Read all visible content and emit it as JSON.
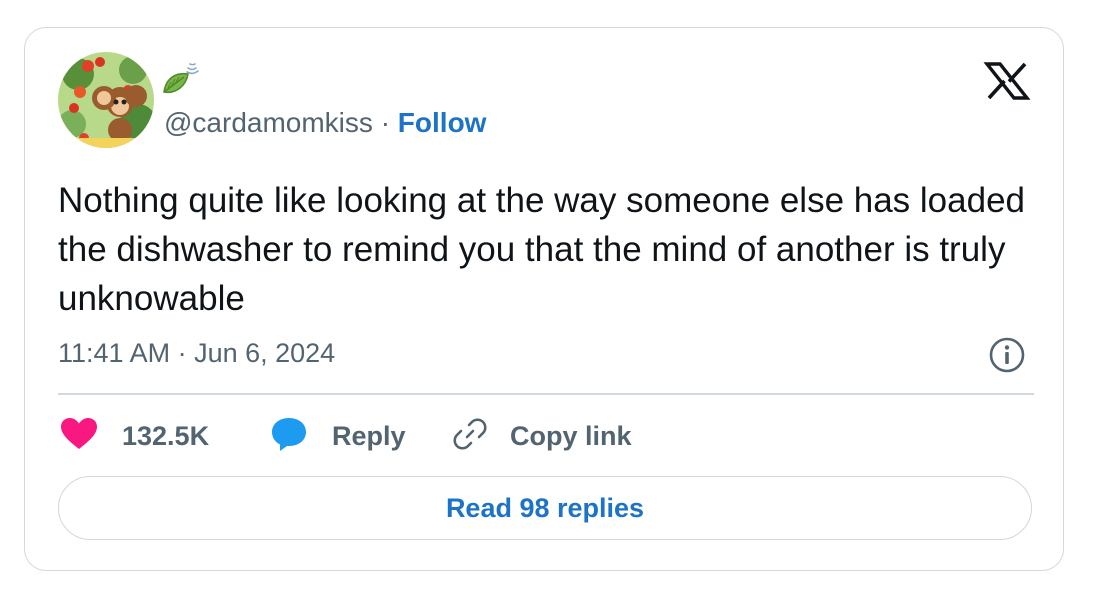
{
  "author": {
    "handle": "@cardamomkiss",
    "separator": "·",
    "follow_label": "Follow",
    "avatar_icon": "cheburashka-flowers-avatar",
    "name_emoji_icon": "leaf-fluttering-in-wind-icon"
  },
  "tweet": {
    "text": "Nothing quite like looking at the way someone else has loaded the dishwasher to remind you that the mind of another is truly unknowable",
    "timestamp": "11:41 AM · Jun 6, 2024"
  },
  "actions": {
    "likes_count": "132.5K",
    "reply_label": "Reply",
    "copy_link_label": "Copy link",
    "read_replies_label": "Read 98 replies"
  },
  "colors": {
    "like": "#f91880",
    "reply_bubble": "#1d9bf0",
    "link": "#1d73c7",
    "muted_text": "#536471",
    "border": "#cfd9de"
  }
}
